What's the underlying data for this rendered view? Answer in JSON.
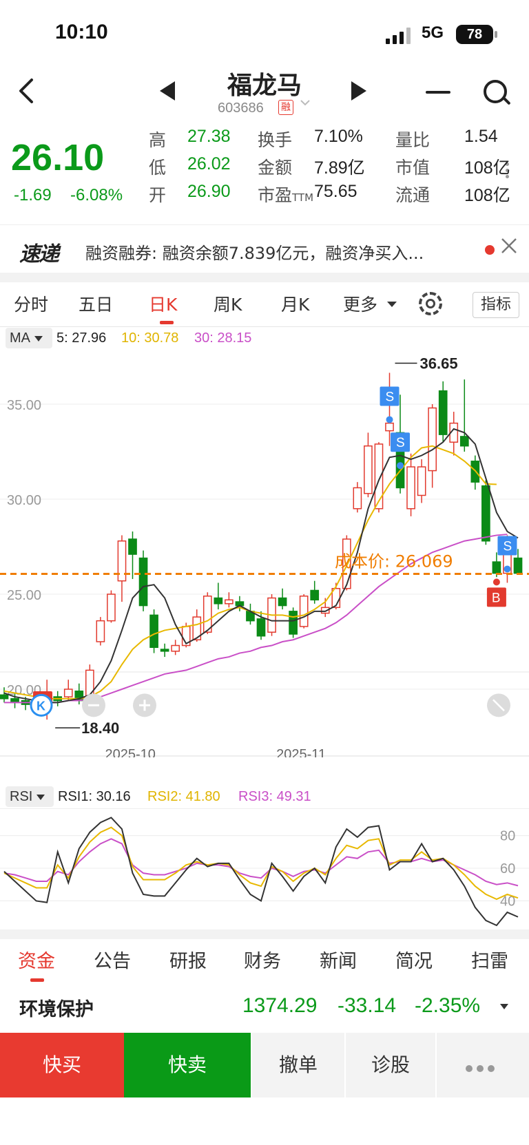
{
  "status": {
    "time": "10:10",
    "network": "5G",
    "battery": "78"
  },
  "header": {
    "name": "福龙马",
    "code": "603686",
    "rong_badge": "融"
  },
  "quote": {
    "price": "26.10",
    "change": "-1.69",
    "change_pct": "-6.08%",
    "fields": [
      {
        "label": "高",
        "value": "27.38",
        "color": "green"
      },
      {
        "label": "换手",
        "value": "7.10%",
        "color": "dark"
      },
      {
        "label": "量比",
        "value": "1.54",
        "color": "dark"
      },
      {
        "label": "低",
        "value": "26.02",
        "color": "green"
      },
      {
        "label": "金额",
        "value": "7.89亿",
        "color": "dark"
      },
      {
        "label": "市值",
        "value": "108亿",
        "color": "dark"
      },
      {
        "label": "开",
        "value": "26.90",
        "color": "green"
      },
      {
        "label": "市盈",
        "label_sub": "TTM",
        "value": "75.65",
        "color": "dark"
      },
      {
        "label": "流通",
        "value": "108亿",
        "color": "dark"
      }
    ]
  },
  "ticker": {
    "logo": "速递",
    "text": "融资融券: 融资余额7.839亿元，融资净买入..."
  },
  "period_tabs": [
    "分时",
    "五日",
    "日K",
    "周K",
    "月K",
    "更多"
  ],
  "active_period": "日K",
  "indicator_button": "指标",
  "kline": {
    "legend": {
      "name": "MA",
      "ma5": "5: 27.96",
      "ma10": "10: 30.78",
      "ma30": "30: 28.15"
    },
    "y_ticks": [
      "35.00",
      "30.00",
      "25.00",
      "20.00"
    ],
    "x_ticks": [
      "2025-10",
      "2025-11"
    ],
    "high_label": "36.65",
    "low_label": "18.40",
    "cost_label": "成本价: 26.069",
    "cost_price": 26.069,
    "marker_s": "S",
    "marker_b": "B",
    "marker_k": "K"
  },
  "rsi": {
    "legend": {
      "name": "RSI",
      "rsi1": "RSI1: 30.16",
      "rsi2": "RSI2: 41.80",
      "rsi3": "RSI3: 49.31"
    },
    "y_ticks": [
      "80",
      "60",
      "40"
    ]
  },
  "chart_data": {
    "type": "candlestick",
    "y_range": [
      17.5,
      37.5
    ],
    "x_ticks": [
      {
        "label": "2025-10",
        "index": 12
      },
      {
        "label": "2025-11",
        "index": 28
      }
    ],
    "candles": [
      {
        "o": 19.7,
        "c": 19.5,
        "h": 20.1,
        "l": 19.3
      },
      {
        "o": 19.5,
        "c": 19.3,
        "h": 19.8,
        "l": 19.0
      },
      {
        "o": 19.4,
        "c": 19.2,
        "h": 19.6,
        "l": 18.9
      },
      {
        "o": 19.3,
        "c": 19.0,
        "h": 19.5,
        "l": 18.7
      },
      {
        "o": 19.2,
        "c": 19.6,
        "h": 20.5,
        "l": 18.4
      },
      {
        "o": 19.6,
        "c": 19.4,
        "h": 19.9,
        "l": 19.1
      },
      {
        "o": 19.6,
        "c": 20.0,
        "h": 20.5,
        "l": 19.4
      },
      {
        "o": 19.9,
        "c": 19.4,
        "h": 20.3,
        "l": 19.2
      },
      {
        "o": 19.6,
        "c": 21.0,
        "h": 21.3,
        "l": 19.5
      },
      {
        "o": 22.5,
        "c": 23.6,
        "h": 23.8,
        "l": 22.3
      },
      {
        "o": 23.6,
        "c": 25.0,
        "h": 25.2,
        "l": 23.5
      },
      {
        "o": 25.7,
        "c": 27.8,
        "h": 28.1,
        "l": 24.6
      },
      {
        "o": 27.9,
        "c": 27.1,
        "h": 28.3,
        "l": 25.8
      },
      {
        "o": 26.9,
        "c": 24.4,
        "h": 27.3,
        "l": 24.1
      },
      {
        "o": 23.9,
        "c": 22.2,
        "h": 24.2,
        "l": 21.9
      },
      {
        "o": 22.1,
        "c": 22.0,
        "h": 22.4,
        "l": 21.7
      },
      {
        "o": 22.0,
        "c": 22.3,
        "h": 22.6,
        "l": 21.8
      },
      {
        "o": 22.3,
        "c": 23.3,
        "h": 23.5,
        "l": 22.2
      },
      {
        "o": 22.6,
        "c": 23.8,
        "h": 24.2,
        "l": 22.5
      },
      {
        "o": 23.0,
        "c": 24.9,
        "h": 25.1,
        "l": 22.9
      },
      {
        "o": 24.8,
        "c": 24.5,
        "h": 25.6,
        "l": 24.2
      },
      {
        "o": 24.5,
        "c": 24.7,
        "h": 25.1,
        "l": 24.3
      },
      {
        "o": 24.6,
        "c": 24.4,
        "h": 24.9,
        "l": 24.1
      },
      {
        "o": 24.1,
        "c": 23.6,
        "h": 24.5,
        "l": 23.4
      },
      {
        "o": 23.7,
        "c": 22.8,
        "h": 24.1,
        "l": 22.6
      },
      {
        "o": 23.0,
        "c": 24.8,
        "h": 25.0,
        "l": 22.8
      },
      {
        "o": 24.8,
        "c": 24.4,
        "h": 25.3,
        "l": 24.2
      },
      {
        "o": 24.1,
        "c": 22.9,
        "h": 24.3,
        "l": 22.7
      },
      {
        "o": 23.3,
        "c": 24.9,
        "h": 25.0,
        "l": 23.2
      },
      {
        "o": 25.2,
        "c": 24.7,
        "h": 25.7,
        "l": 24.5
      },
      {
        "o": 24.0,
        "c": 24.3,
        "h": 24.8,
        "l": 23.8
      },
      {
        "o": 24.3,
        "c": 25.3,
        "h": 25.6,
        "l": 24.2
      },
      {
        "o": 25.3,
        "c": 27.9,
        "h": 28.1,
        "l": 25.2
      },
      {
        "o": 29.5,
        "c": 30.6,
        "h": 30.9,
        "l": 29.3
      },
      {
        "o": 30.3,
        "c": 32.8,
        "h": 33.5,
        "l": 30.1
      },
      {
        "o": 29.5,
        "c": 32.9,
        "h": 33.0,
        "l": 29.3
      },
      {
        "o": 33.6,
        "c": 34.0,
        "h": 36.65,
        "l": 32.8
      },
      {
        "o": 33.5,
        "c": 30.6,
        "h": 35.5,
        "l": 30.3
      },
      {
        "o": 29.5,
        "c": 31.7,
        "h": 32.4,
        "l": 29.1
      },
      {
        "o": 30.2,
        "c": 31.7,
        "h": 32.1,
        "l": 29.8
      },
      {
        "o": 31.5,
        "c": 34.8,
        "h": 35.0,
        "l": 30.6
      },
      {
        "o": 35.7,
        "c": 33.4,
        "h": 36.2,
        "l": 33.0
      },
      {
        "o": 33.0,
        "c": 34.0,
        "h": 34.6,
        "l": 32.3
      },
      {
        "o": 33.3,
        "c": 32.8,
        "h": 36.3,
        "l": 32.5
      },
      {
        "o": 32.0,
        "c": 30.9,
        "h": 32.3,
        "l": 30.5
      },
      {
        "o": 30.7,
        "c": 27.8,
        "h": 31.0,
        "l": 27.6
      },
      {
        "o": 26.7,
        "c": 26.1,
        "h": 27.2,
        "l": 25.9
      },
      {
        "o": 26.1,
        "c": 27.6,
        "h": 28.1,
        "l": 25.6
      },
      {
        "o": 26.9,
        "c": 26.1,
        "h": 27.38,
        "l": 26.02
      }
    ],
    "ma5": [
      19.8,
      19.6,
      19.5,
      19.4,
      19.3,
      19.3,
      19.4,
      19.5,
      19.7,
      20.4,
      21.5,
      23.1,
      24.8,
      25.4,
      25.5,
      24.8,
      23.4,
      22.4,
      22.7,
      23.1,
      23.6,
      24.1,
      24.4,
      24.1,
      23.8,
      23.6,
      23.6,
      23.6,
      23.8,
      24.1,
      24.1,
      24.4,
      25.5,
      27.2,
      29.5,
      31.0,
      32.2,
      32.3,
      32.1,
      32.3,
      32.6,
      33.0,
      33.7,
      33.5,
      32.9,
      31.1,
      29.3,
      28.3,
      27.96
    ],
    "ma10": [
      19.9,
      19.8,
      19.7,
      19.6,
      19.5,
      19.5,
      19.5,
      19.5,
      19.6,
      19.9,
      20.4,
      21.3,
      22.1,
      22.6,
      22.9,
      23.1,
      23.2,
      23.3,
      23.4,
      23.6,
      24.0,
      24.2,
      24.3,
      24.1,
      24.0,
      23.9,
      23.9,
      23.8,
      23.9,
      24.2,
      24.6,
      25.4,
      26.5,
      27.7,
      28.9,
      29.9,
      30.8,
      31.5,
      32.2,
      32.7,
      32.8,
      32.6,
      32.4,
      32.0,
      31.5,
      30.8,
      30.78
    ],
    "ma30": [
      19.3,
      19.3,
      19.3,
      19.3,
      19.3,
      19.3,
      19.4,
      19.4,
      19.5,
      19.6,
      19.8,
      20.0,
      20.2,
      20.4,
      20.6,
      20.8,
      20.9,
      21.0,
      21.2,
      21.4,
      21.6,
      21.7,
      21.9,
      22.0,
      22.2,
      22.3,
      22.5,
      22.6,
      22.8,
      23.0,
      23.2,
      23.5,
      23.9,
      24.4,
      24.9,
      25.4,
      25.8,
      26.2,
      26.6,
      26.9,
      27.2,
      27.4,
      27.6,
      27.8,
      27.9,
      28.0,
      28.1,
      28.15
    ],
    "rsi_range": [
      25,
      95
    ],
    "rsi1": [
      58,
      52,
      46,
      40,
      39,
      70,
      51,
      72,
      82,
      88,
      91,
      84,
      57,
      44,
      43,
      43,
      51,
      59,
      66,
      61,
      63,
      63,
      53,
      44,
      40,
      63,
      55,
      46,
      55,
      60,
      51,
      73,
      84,
      79,
      85,
      86,
      59,
      64,
      64,
      75,
      64,
      66,
      59,
      49,
      36,
      28,
      25,
      33,
      30.16
    ],
    "rsi2": [
      57,
      54,
      51,
      48,
      48,
      62,
      54,
      67,
      76,
      82,
      85,
      80,
      61,
      53,
      53,
      53,
      57,
      62,
      64,
      62,
      63,
      62,
      56,
      51,
      49,
      61,
      58,
      52,
      57,
      60,
      56,
      66,
      74,
      72,
      77,
      78,
      62,
      65,
      65,
      70,
      65,
      66,
      62,
      56,
      49,
      44,
      41,
      44,
      41.8
    ],
    "rsi3": [
      57,
      56,
      54,
      52,
      52,
      58,
      56,
      64,
      70,
      75,
      78,
      75,
      62,
      57,
      56,
      56,
      58,
      60,
      63,
      62,
      62,
      61,
      57,
      55,
      54,
      60,
      58,
      55,
      58,
      59,
      57,
      62,
      67,
      66,
      70,
      71,
      63,
      64,
      64,
      66,
      64,
      65,
      62,
      59,
      56,
      52,
      50,
      51,
      49.31
    ]
  }
}
